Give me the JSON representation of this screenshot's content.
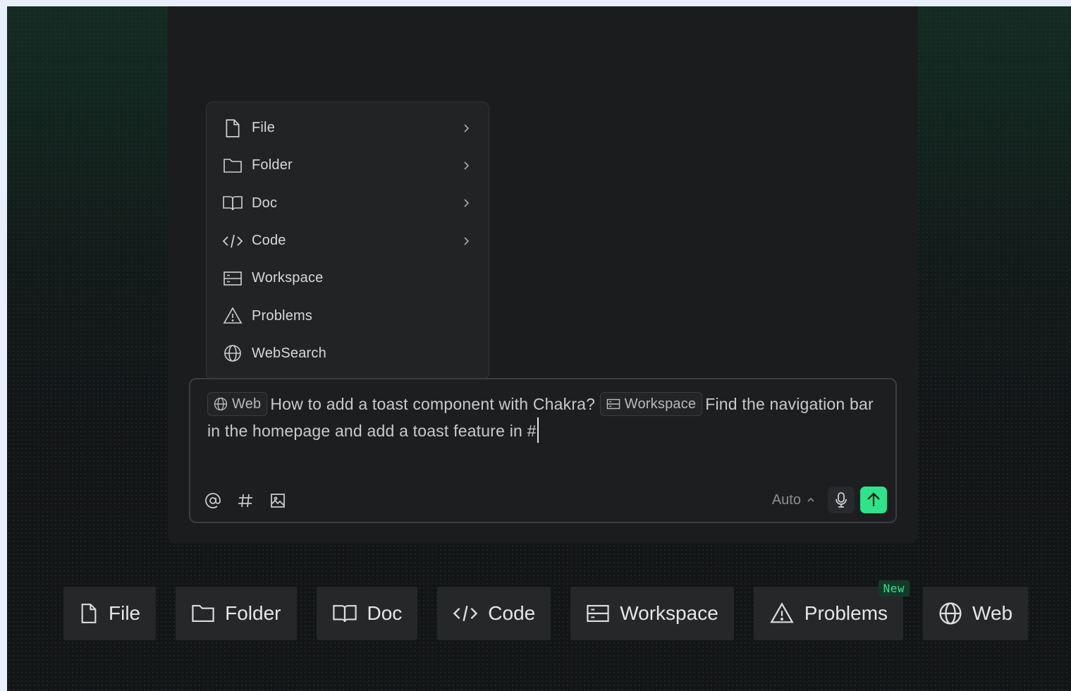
{
  "menu": {
    "items": [
      {
        "label": "File",
        "icon": "file-icon",
        "has_submenu": true
      },
      {
        "label": "Folder",
        "icon": "folder-icon",
        "has_submenu": true
      },
      {
        "label": "Doc",
        "icon": "book-icon",
        "has_submenu": true
      },
      {
        "label": "Code",
        "icon": "code-icon",
        "has_submenu": true
      },
      {
        "label": "Workspace",
        "icon": "workspace-icon",
        "has_submenu": false
      },
      {
        "label": "Problems",
        "icon": "warning-icon",
        "has_submenu": false
      },
      {
        "label": "WebSearch",
        "icon": "globe-icon",
        "has_submenu": false
      }
    ]
  },
  "input": {
    "chip_web": "Web",
    "text_1": "How to add a toast component with Chakra?",
    "chip_workspace": "Workspace",
    "text_2": "Find the navigation bar in the homepage and add a toast feature in #",
    "tools": {
      "mention": "@",
      "hash": "#"
    },
    "model_select": "Auto"
  },
  "bottom_bar": {
    "items": [
      {
        "label": "File",
        "icon": "file-icon"
      },
      {
        "label": "Folder",
        "icon": "folder-icon"
      },
      {
        "label": "Doc",
        "icon": "book-icon"
      },
      {
        "label": "Code",
        "icon": "code-icon"
      },
      {
        "label": "Workspace",
        "icon": "workspace-icon"
      },
      {
        "label": "Problems",
        "icon": "warning-icon",
        "badge": "New"
      },
      {
        "label": "Web",
        "icon": "globe-icon"
      }
    ]
  },
  "colors": {
    "accent": "#2ee38a",
    "badge_text": "#3ddc8a",
    "panel": "#1b1c1e",
    "background": "#131517"
  }
}
